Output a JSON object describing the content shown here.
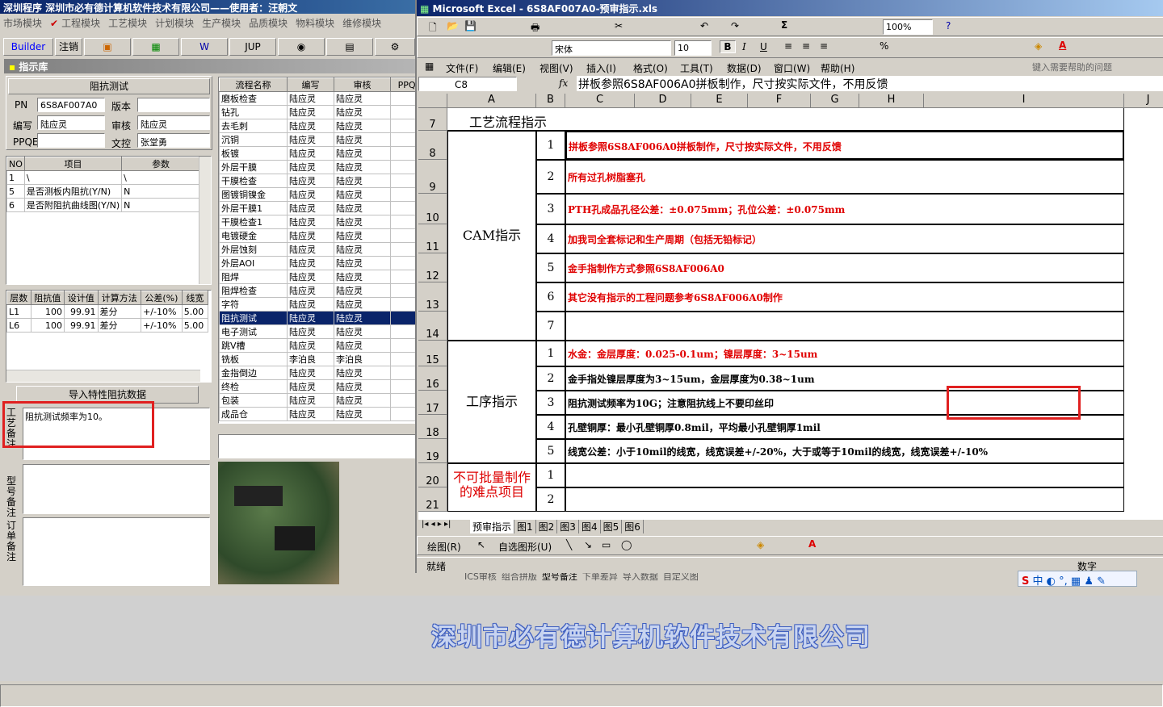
{
  "app": {
    "title": "深圳程序    深圳市必有德计算机软件技术有限公司——使用者：汪朝文",
    "menu": [
      "市场模块",
      "工程模块",
      "工艺模块",
      "计划模块",
      "生产模块",
      "品质模块",
      "物料模块",
      "维修模块"
    ],
    "toolbar": {
      "builder": "Builder",
      "login": "注销",
      "jup": "JUP"
    },
    "panel_title": "指示库",
    "section_title": "阻抗测试",
    "fields": {
      "pn_label": "PN",
      "pn": "6S8AF007A0",
      "version_label": "版本",
      "version": "",
      "writer_label": "编写",
      "writer": "陆应灵",
      "reviewer_label": "审核",
      "reviewer": "陆应灵",
      "ppqe_label": "PPQE",
      "ppqe": "",
      "doc_label": "文控",
      "doc": "张堂勇"
    },
    "items_table": {
      "headers": [
        "NO",
        "项目",
        "参数"
      ],
      "rows": [
        [
          "1",
          "\\",
          "\\"
        ],
        [
          "5",
          "是否测板内阻抗(Y/N)",
          "N"
        ],
        [
          "6",
          "是否附阻抗曲线图(Y/N)",
          "N"
        ]
      ]
    },
    "imp_table": {
      "headers": [
        "层数",
        "阻抗值",
        "设计值",
        "计算方法",
        "公差(%)",
        "线宽"
      ],
      "rows": [
        [
          "L1",
          "100",
          "99.91",
          "差分",
          "+/-10%",
          "5.00"
        ],
        [
          "L6",
          "100",
          "99.91",
          "差分",
          "+/-10%",
          "5.00"
        ]
      ]
    },
    "import_button": "导入特性阻抗数据",
    "notes": {
      "craft_label": "工艺备注",
      "craft": "阻抗测试频率为10。",
      "model_label": "型号备注",
      "order_label": "订单备注"
    },
    "flow_table": {
      "headers": [
        "流程名称",
        "编写",
        "审核",
        "PPQE"
      ],
      "rows": [
        [
          "磨板检查",
          "陆应灵",
          "陆应灵"
        ],
        [
          "钻孔",
          "陆应灵",
          "陆应灵"
        ],
        [
          "去毛刺",
          "陆应灵",
          "陆应灵"
        ],
        [
          "沉铜",
          "陆应灵",
          "陆应灵"
        ],
        [
          "板镀",
          "陆应灵",
          "陆应灵"
        ],
        [
          "外层干膜",
          "陆应灵",
          "陆应灵"
        ],
        [
          "干膜检查",
          "陆应灵",
          "陆应灵"
        ],
        [
          "图镀铜镍金",
          "陆应灵",
          "陆应灵"
        ],
        [
          "外层干膜1",
          "陆应灵",
          "陆应灵"
        ],
        [
          "干膜检查1",
          "陆应灵",
          "陆应灵"
        ],
        [
          "电镀硬金",
          "陆应灵",
          "陆应灵"
        ],
        [
          "外层蚀刻",
          "陆应灵",
          "陆应灵"
        ],
        [
          "外层AOI",
          "陆应灵",
          "陆应灵"
        ],
        [
          "阻焊",
          "陆应灵",
          "陆应灵"
        ],
        [
          "阻焊检查",
          "陆应灵",
          "陆应灵"
        ],
        [
          "字符",
          "陆应灵",
          "陆应灵"
        ],
        [
          "阻抗测试",
          "陆应灵",
          "陆应灵"
        ],
        [
          "电子测试",
          "陆应灵",
          "陆应灵"
        ],
        [
          "跳V槽",
          "陆应灵",
          "陆应灵"
        ],
        [
          "铣板",
          "李泊良",
          "李泊良"
        ],
        [
          "金指倒边",
          "陆应灵",
          "陆应灵"
        ],
        [
          "终检",
          "陆应灵",
          "陆应灵"
        ],
        [
          "包装",
          "陆应灵",
          "陆应灵"
        ],
        [
          "成品仓",
          "陆应灵",
          "陆应灵"
        ]
      ],
      "selected": 16
    },
    "bottom_tabs": [
      "ICS审核",
      "组合拼版",
      "型号备注",
      "下单差异",
      "导入数据",
      "自定义图"
    ],
    "company_banner": "深圳市必有德计算机软件技术有限公司"
  },
  "excel": {
    "title": "Microsoft Excel - 6S8AF007A0-预审指示.xls",
    "font": "宋体",
    "size": "10",
    "zoom": "100%",
    "menu": [
      "文件(F)",
      "编辑(E)",
      "视图(V)",
      "插入(I)",
      "格式(O)",
      "工具(T)",
      "数据(D)",
      "窗口(W)",
      "帮助(H)"
    ],
    "help_placeholder": "键入需要帮助的问题",
    "cell_ref": "C8",
    "fx": "fx",
    "formula": "拼板参照6S8AF006A0拼板制作，尺寸按实际文件，不用反馈",
    "cols": [
      "A",
      "B",
      "C",
      "D",
      "E",
      "F",
      "G",
      "H",
      "I",
      "J"
    ],
    "header_row": {
      "row": "7",
      "text": "工艺流程指示"
    },
    "cam_label": "CAM指示",
    "proc_label": "工序指示",
    "hard_label": "不可批量制作的难点项目",
    "rows": [
      {
        "r": "8",
        "n": "1",
        "text": "拼板参照6S8AF006A0拼板制作，尺寸按实际文件，不用反馈",
        "red": true
      },
      {
        "r": "9",
        "n": "2",
        "text": "所有过孔树脂塞孔",
        "red": true
      },
      {
        "r": "10",
        "n": "3",
        "text": "PTH孔成品孔径公差：±0.075mm；孔位公差：±0.075mm",
        "red": true
      },
      {
        "r": "11",
        "n": "4",
        "text": "加我司全套标记和生产周期（包括无铅标记）",
        "red": true
      },
      {
        "r": "12",
        "n": "5",
        "text": "金手指制作方式参照6S8AF006A0",
        "red": true
      },
      {
        "r": "13",
        "n": "6",
        "text": "其它没有指示的工程问题参考6S8AF006A0制作",
        "red": true
      },
      {
        "r": "14",
        "n": "7",
        "text": "",
        "red": true
      },
      {
        "r": "15",
        "n": "1",
        "text": "水金：金层厚度：0.025-0.1um；镍层厚度：3~15um",
        "red": true
      },
      {
        "r": "16",
        "n": "2",
        "text": "金手指处镍层厚度为3~15um，金层厚度为0.38~1um",
        "red": false
      },
      {
        "r": "17",
        "n": "3",
        "text": "阻抗测试频率为10G；注意阻抗线上不要印丝印",
        "red": false
      },
      {
        "r": "18",
        "n": "4",
        "text": "孔壁铜厚：最小孔壁铜厚0.8mil，平均最小孔壁铜厚1mil",
        "red": false
      },
      {
        "r": "19",
        "n": "5",
        "text": "线宽公差：小于10mil的线宽，线宽误差+/-20%，大于或等于10mil的线宽，线宽误差+/-10%",
        "red": false
      },
      {
        "r": "20",
        "n": "1",
        "text": "",
        "red": false
      },
      {
        "r": "21",
        "n": "2",
        "text": "",
        "red": false
      }
    ],
    "sheet_tabs": [
      "预审指示",
      "图1",
      "图2",
      "图3",
      "图4",
      "图5",
      "图6"
    ],
    "draw_label": "绘图(R)",
    "autoshape": "自选图形(U)",
    "status": "就绪",
    "status_right": "数字",
    "ime": "中"
  }
}
